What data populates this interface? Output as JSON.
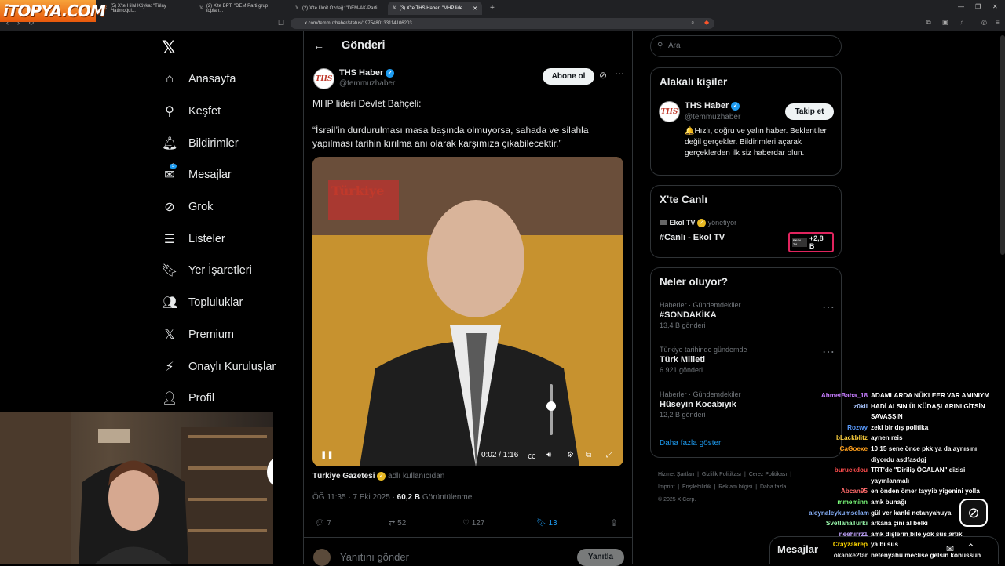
{
  "browser": {
    "tabs": [
      "(5) X'te Hilal Köyka: \"Tülay Hatimoğul...",
      "(2) X'te BPT: \"DEM Parti grup toplan...",
      "(2) X'te Ümit Özdağ: \"DEM-AK-Parti...",
      "(3) X'te THS Haber: \"MHP lide..."
    ],
    "url": "x.com/temmuzhaber/status/1975480133114106203",
    "watermark": "iTOPYA.COM"
  },
  "nav": {
    "items": [
      {
        "label": "Anasayfa",
        "icon": "home-icon"
      },
      {
        "label": "Keşfet",
        "icon": "search-icon"
      },
      {
        "label": "Bildirimler",
        "icon": "bell-icon"
      },
      {
        "label": "Mesajlar",
        "icon": "mail-icon",
        "badge": "3"
      },
      {
        "label": "Grok",
        "icon": "grok-icon"
      },
      {
        "label": "Listeler",
        "icon": "list-icon"
      },
      {
        "label": "Yer İşaretleri",
        "icon": "bookmark-icon"
      },
      {
        "label": "Topluluklar",
        "icon": "people-icon"
      },
      {
        "label": "Premium",
        "icon": "x-icon"
      },
      {
        "label": "Onaylı Kuruluşlar",
        "icon": "lightning-icon"
      },
      {
        "label": "Profil",
        "icon": "person-icon"
      }
    ]
  },
  "post": {
    "header": "Gönderi",
    "author": "THS Haber",
    "handle": "@temmuzhaber",
    "subscribe": "Abone ol",
    "avatar_text": "THS",
    "line1": "MHP lideri Devlet Bahçeli:",
    "line2": "“İsrail’in durdurulması masa başında olmuyorsa, sahada ve silahla yapılması tarihin kırılma anı olarak karşımıza çıkabilecektir.”",
    "video": {
      "overlay": "Türkiye",
      "time": "0:02 / 1:16"
    },
    "source_name": "Türkiye Gazetesi",
    "source_suffix": "adlı kullanıcıdan",
    "time": "ÖĞ 11:35 · 7 Eki 2025 ·",
    "views": "60,2 B",
    "views_label": "Görüntülenme",
    "stats": {
      "replies": "7",
      "reposts": "52",
      "likes": "127",
      "bookmarks": "13"
    },
    "reply_placeholder": "Yanıtını gönder",
    "reply_button": "Yanıtla"
  },
  "right": {
    "search_placeholder": "Ara",
    "related": {
      "title": "Alakalı kişiler",
      "name": "THS Haber",
      "handle": "@temmuzhaber",
      "follow": "Takip et",
      "bio": "🔔Hızlı, doğru ve yalın haber. Beklentiler değil gerçekler. Bildirimleri açarak gerçeklerden ilk siz haberdar olun."
    },
    "live": {
      "title": "X'te Canlı",
      "host": "Ekol TV",
      "host_suffix": "yönetiyor",
      "name": "#Canlı - Ekol TV",
      "count": "+2,8 B",
      "badge": "EKOL TV"
    },
    "trends": {
      "title": "Neler oluyor?",
      "items": [
        {
          "meta": "Haberler · Gündemdekiler",
          "name": "#SONDAKİKA",
          "count": "13,4 B gönderi"
        },
        {
          "meta": "Türkiye tarihinde gündemde",
          "name": "Türk Milleti",
          "count": "6.921 gönderi"
        },
        {
          "meta": "Haberler · Gündemdekiler",
          "name": "Hüseyin Kocabıyık",
          "count": "12,2 B gönderi"
        }
      ],
      "more": "Daha fazla göster"
    },
    "footer": [
      "Hizmet Şartları",
      "Gizlilik Politikası",
      "Çerez Politikası",
      "Imprint",
      "Erişilebilirlik",
      "Reklam bilgisi",
      "Daha fazla ...",
      "© 2025 X Corp."
    ],
    "messages": "Mesajlar"
  },
  "chat": [
    {
      "u": "AhmetBaba_18",
      "c": "#c77dff",
      "m": "ADAMLARDA NÜKLEER VAR AMINIYM"
    },
    {
      "u": "z0kil",
      "c": "#a9c6ff",
      "m": "HADİ ALSIN ÜLKÜDAŞLARINI GİTSİN"
    },
    {
      "u": "",
      "c": "#fff",
      "m": "SAVAŞŞIN"
    },
    {
      "u": "Rozwy",
      "c": "#5a9cff",
      "m": "zeki bir dış politika"
    },
    {
      "u": "bLackblitz",
      "c": "#ffd23f",
      "m": "aynen reis"
    },
    {
      "u": "CaGoexe",
      "c": "#ff9f1c",
      "m": "10 15 sene önce pkk ya da aynısını"
    },
    {
      "u": "",
      "c": "#fff",
      "m": "diyordu asdfasdgj"
    },
    {
      "u": "buruckdou",
      "c": "#ff4d4d",
      "m": "TRT'de \"Diriliş ÖCALAN\" dizisi"
    },
    {
      "u": "",
      "c": "#fff",
      "m": "yayınlanmalı"
    },
    {
      "u": "Abcan95",
      "c": "#ff6b6b",
      "m": "en önden ömer tayyib yigenini yolla"
    },
    {
      "u": "mmeminn",
      "c": "#7cff7c",
      "m": "amk bunağı"
    },
    {
      "u": "aleynaleykumselam",
      "c": "#8ab4ff",
      "m": "gül ver kanki netanyahuya"
    },
    {
      "u": "SvetlanaTurki",
      "c": "#9dffb0",
      "m": "arkana çini al belki"
    },
    {
      "u": "neehirrz1",
      "c": "#c3a6ff",
      "m": "amk dişlerin bile yok sus artık"
    },
    {
      "u": "Crayzakrep",
      "c": "#ffd700",
      "m": "ya bi sus"
    },
    {
      "u": "okanke2far",
      "c": "#e0e0e0",
      "m": "netenyahu meclise gelsin konussun"
    }
  ]
}
